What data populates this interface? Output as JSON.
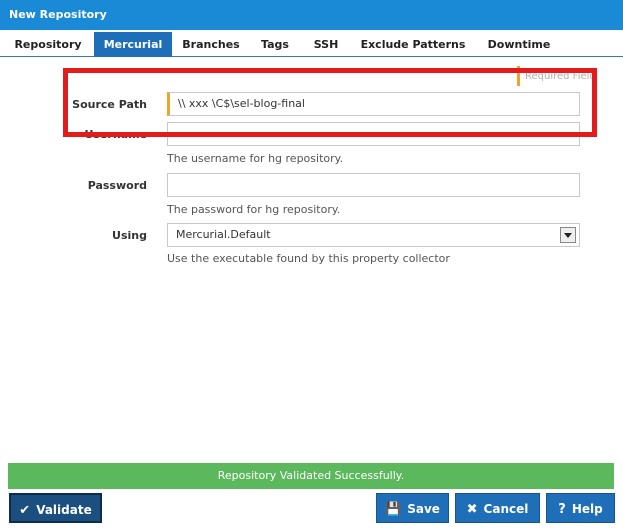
{
  "window": {
    "title": "New Repository"
  },
  "tabs": [
    {
      "label": "Repository"
    },
    {
      "label": "Mercurial"
    },
    {
      "label": "Branches"
    },
    {
      "label": "Tags"
    },
    {
      "label": "SSH"
    },
    {
      "label": "Exclude Patterns"
    },
    {
      "label": "Downtime"
    }
  ],
  "form": {
    "required_hint": "Required Field",
    "source_path": {
      "label": "Source Path",
      "value": "\\\\  xxx  \\C$\\sel-blog-final"
    },
    "username": {
      "label": "Username",
      "value": "",
      "help": "The username for hg repository."
    },
    "password": {
      "label": "Password",
      "value": "",
      "help": "The password for hg repository."
    },
    "using": {
      "label": "Using",
      "value": "Mercurial.Default",
      "help": "Use the executable found by this property collector"
    }
  },
  "status": {
    "message": "Repository Validated Successfully.",
    "color": "#5cb85c"
  },
  "buttons": {
    "validate": {
      "label": "Validate",
      "icon": "check-circle-icon"
    },
    "save": {
      "label": "Save",
      "icon": "floppy-icon"
    },
    "cancel": {
      "label": "Cancel",
      "icon": "x-icon"
    },
    "help": {
      "label": "Help",
      "icon": "question-circle-icon"
    }
  },
  "colors": {
    "accent": "#1a8ad6",
    "active_tab": "#1f6fb8",
    "required": "#f0a32a",
    "highlight": "#e41b1b"
  }
}
